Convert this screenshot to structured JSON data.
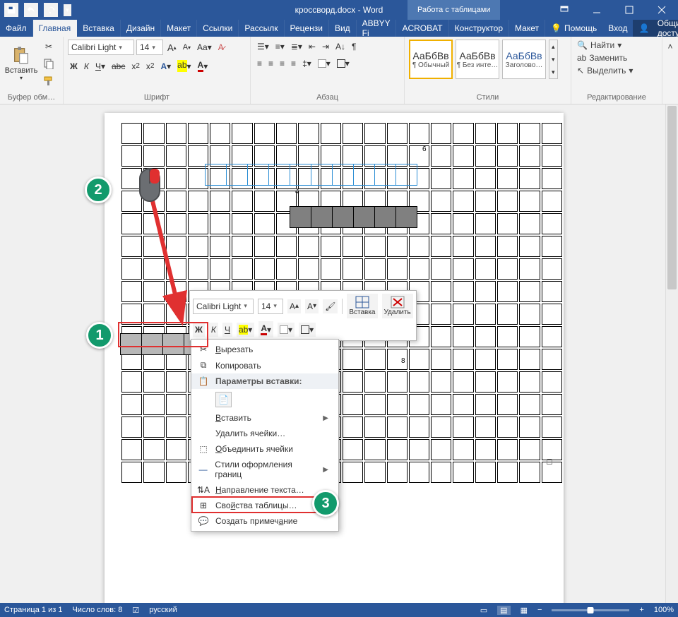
{
  "title": "кроссворд.docx - Word",
  "context_tab": "Работа с таблицами",
  "tabs": {
    "file": "Файл",
    "home": "Главная",
    "insert": "Вставка",
    "design": "Дизайн",
    "layout": "Макет",
    "references": "Ссылки",
    "mailings": "Рассылк",
    "review": "Рецензи",
    "view": "Вид",
    "abbyy": "ABBYY Fi",
    "acrobat": "ACROBAT",
    "t_design": "Конструктор",
    "t_layout": "Макет",
    "tell": "Помощь",
    "signin": "Вход",
    "share": "Общий доступ"
  },
  "ribbon": {
    "clipboard": {
      "label": "Буфер обм…",
      "paste": "Вставить"
    },
    "font": {
      "label": "Шрифт",
      "family": "Calibri Light",
      "size": "14"
    },
    "para": {
      "label": "Абзац"
    },
    "styles": {
      "label": "Стили",
      "sample": "АаБбВв",
      "normal": "¶ Обычный",
      "nospace": "¶ Без инте…",
      "heading1": "Заголово…"
    },
    "editing": {
      "label": "Редактирование",
      "find": "Найти",
      "replace": "Заменить",
      "select": "Выделить"
    }
  },
  "contextmenu": {
    "cut": "Вырезать",
    "copy": "Копировать",
    "paste_header": "Параметры вставки:",
    "insert": "Вставить",
    "delete": "Удалить ячейки…",
    "merge": "Объединить ячейки",
    "border_styles": "Стили оформления границ",
    "text_dir": "Направление текста…",
    "table_props": "Свойства таблицы…",
    "comment": "Создать примечание"
  },
  "mini": {
    "font": "Calibri Light",
    "size": "14",
    "insert": "Вставка",
    "delete": "Удалить"
  },
  "grid_numbers": {
    "a": "6",
    "b": "4",
    "c": "8"
  },
  "status": {
    "page": "Страница 1 из 1",
    "words": "Число слов: 8",
    "lang": "русский",
    "zoom": "100%",
    "minus": "−",
    "plus": "+"
  },
  "callouts": {
    "c1": "1",
    "c2": "2",
    "c3": "3"
  }
}
